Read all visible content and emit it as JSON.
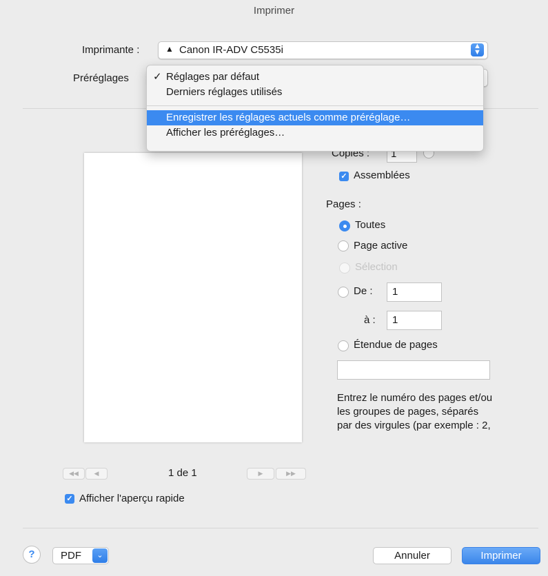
{
  "window": {
    "title": "Imprimer"
  },
  "printer": {
    "label": "Imprimante :",
    "value": "Canon IR-ADV C5535i",
    "warning_icon": "▲"
  },
  "presets": {
    "label": "Préréglages",
    "menu": {
      "items": [
        {
          "label": "Réglages par défaut",
          "checked": true
        },
        {
          "label": "Derniers réglages utilisés",
          "checked": false
        }
      ],
      "actions": [
        {
          "label": "Enregistrer les réglages actuels comme préréglage…",
          "highlighted": true
        },
        {
          "label": "Afficher les préréglages…",
          "highlighted": false
        }
      ]
    }
  },
  "copies": {
    "label": "Copies :",
    "value": "1"
  },
  "collated": {
    "label": "Assemblées",
    "checked": true
  },
  "pages": {
    "label": "Pages :",
    "options": {
      "all": "Toutes",
      "current": "Page active",
      "selection": "Sélection",
      "from": "De :",
      "to": "à :",
      "range": "Étendue de pages"
    },
    "from_value": "1",
    "to_value": "1",
    "range_value": "",
    "help": "Entrez le numéro des pages et/ou les groupes de pages, séparés par des virgules (par exemple : 2,"
  },
  "preview": {
    "page_count": "1 de 1",
    "first_icon": "◀◀",
    "prev_icon": "◀",
    "next_icon": "▶",
    "last_icon": "▶▶"
  },
  "quick_preview": {
    "label": "Afficher l'aperçu rapide",
    "checked": true
  },
  "footer": {
    "help_icon": "?",
    "pdf_label": "PDF",
    "cancel_label": "Annuler",
    "print_label": "Imprimer"
  },
  "colors": {
    "accent": "#3b8af0",
    "background": "#ececec"
  }
}
